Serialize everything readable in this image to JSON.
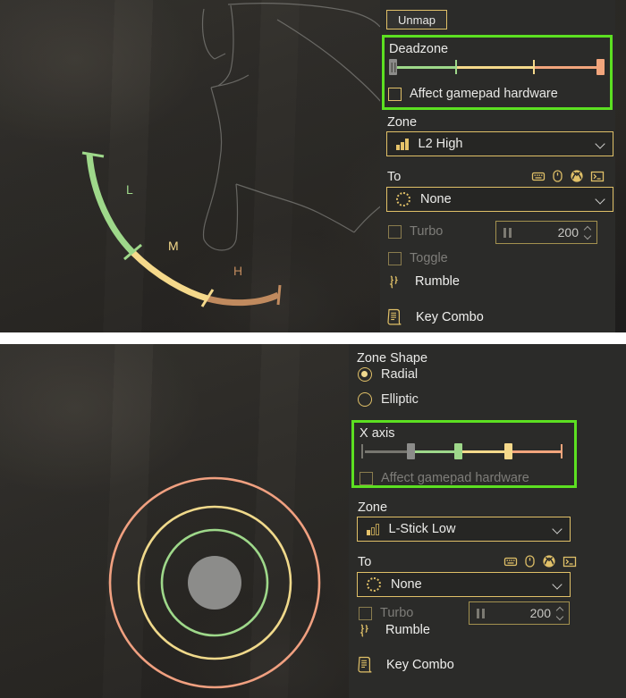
{
  "top_panel": {
    "unmap_button": "Unmap",
    "deadzone": {
      "title": "Deadzone",
      "affect_hardware_label": "Affect gamepad hardware",
      "affect_hardware_checked": false,
      "slider": {
        "handle_left_pct": 0,
        "stops_pct": [
          31,
          67,
          100
        ],
        "segment_colors": [
          "#9ed88a",
          "#f5d98b",
          "#f2a57c"
        ],
        "handle_color": "#8c8c8a"
      }
    },
    "zone": {
      "label": "Zone",
      "value": "L2 High",
      "icon": "bar-chart-high-icon"
    },
    "to": {
      "label": "To",
      "value": "None",
      "icon": "dotted-circle-icon",
      "source_icons": [
        "keyboard-icon",
        "mouse-icon",
        "xbox-icon",
        "console-icon"
      ]
    },
    "turbo": {
      "label": "Turbo",
      "checked": false,
      "value": "200"
    },
    "toggle": {
      "label": "Toggle",
      "checked": false
    },
    "rumble": {
      "label": "Rumble",
      "icon": "rumble-waves-icon"
    },
    "key_combo": {
      "label": "Key Combo",
      "icon": "scroll-icon"
    },
    "visualization": {
      "type": "trigger-arc",
      "segments": [
        {
          "name": "L",
          "color": "#9ed88a"
        },
        {
          "name": "M",
          "color": "#f5d98b"
        },
        {
          "name": "H",
          "color": "#c08a5e"
        }
      ]
    }
  },
  "bottom_panel": {
    "zone_shape": {
      "title": "Zone Shape",
      "options": [
        "Radial",
        "Elliptic"
      ],
      "selected": "Radial"
    },
    "x_axis": {
      "title": "X axis",
      "affect_hardware_label": "Affect gamepad hardware",
      "affect_hardware_checked": false,
      "slider": {
        "handle_left_pct": 24,
        "stops_pct": [
          49,
          73,
          100
        ],
        "segment_colors": [
          "#9ed88a",
          "#f5d98b",
          "#f2a57c"
        ],
        "deadzone_color": "#77766f",
        "handle_color": "#8c8c8a"
      }
    },
    "zone": {
      "label": "Zone",
      "value": "L-Stick Low",
      "icon": "bar-chart-low-icon"
    },
    "to": {
      "label": "To",
      "value": "None",
      "icon": "dotted-circle-icon",
      "source_icons": [
        "keyboard-icon",
        "mouse-icon",
        "xbox-icon",
        "console-icon"
      ]
    },
    "turbo": {
      "label": "Turbo",
      "checked": false,
      "value": "200"
    },
    "rumble": {
      "label": "Rumble",
      "icon": "rumble-waves-icon"
    },
    "key_combo": {
      "label": "Key Combo",
      "icon": "scroll-icon"
    },
    "visualization": {
      "type": "stick-radial-zones",
      "rings": [
        {
          "name": "deadzone",
          "color": "#8c8c8a",
          "filled": true
        },
        {
          "name": "low",
          "color": "#9ed88a",
          "filled": false
        },
        {
          "name": "mid",
          "color": "#f0d98b",
          "filled": false
        },
        {
          "name": "high",
          "color": "#f0a080",
          "filled": false
        }
      ]
    }
  },
  "colors": {
    "highlight": "#5ce021",
    "accent": "#e0c068",
    "panel": "#2b2b29",
    "text": "#eaeae8",
    "text_dim": "#7e7d79"
  }
}
